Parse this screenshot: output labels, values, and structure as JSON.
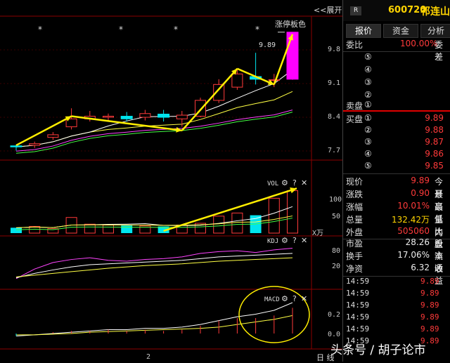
{
  "header": {
    "expand_label": "<<展开",
    "badge": "R",
    "code": "600720",
    "name": "祁连山"
  },
  "tabs": [
    {
      "label": "报价",
      "active": true
    },
    {
      "label": "资金",
      "active": false
    },
    {
      "label": "分析",
      "active": false
    }
  ],
  "main_pane": {
    "limit_label": "涨停板色",
    "limit_price_label": "9.89",
    "stars": [
      "*",
      "*",
      "*",
      "*"
    ],
    "y_ticks": [
      "9.8",
      "9.1",
      "8.4",
      "7.7"
    ]
  },
  "vol_pane": {
    "title": "VOL",
    "y_ticks": [
      "100",
      "50"
    ],
    "unit": "X万"
  },
  "kdj_pane": {
    "title": "KDJ",
    "y_ticks": [
      "80",
      "20"
    ]
  },
  "macd_pane": {
    "title": "MACD",
    "y_ticks": [
      "0.2",
      "0.0"
    ]
  },
  "x_axis": {
    "label": "2",
    "period": "日 线"
  },
  "order_book": {
    "weibi_label": "委比",
    "weibi_value": "100.00%",
    "weicha_label": "委差",
    "sell_label": "卖盘",
    "sell_levels": [
      "⑤",
      "④",
      "③",
      "②",
      "①"
    ],
    "buy_label": "买盘",
    "buy_levels": [
      {
        "level": "①",
        "price": "9.89"
      },
      {
        "level": "②",
        "price": "9.88"
      },
      {
        "level": "③",
        "price": "9.87"
      },
      {
        "level": "④",
        "price": "9.86"
      },
      {
        "level": "⑤",
        "price": "9.85"
      }
    ]
  },
  "quote": [
    {
      "label": "现价",
      "value": "9.89",
      "color": "red",
      "extra": "今开"
    },
    {
      "label": "涨跌",
      "value": "0.90",
      "color": "red",
      "extra": "最高"
    },
    {
      "label": "涨幅",
      "value": "10.01%",
      "color": "red",
      "extra": "最低"
    },
    {
      "label": "总量",
      "value": "132.42万",
      "color": "yel",
      "extra": "量比"
    },
    {
      "label": "外盘",
      "value": "505060",
      "color": "red",
      "extra": "内盘"
    }
  ],
  "stats": [
    {
      "label": "市盈",
      "value": "28.26",
      "extra": "股本"
    },
    {
      "label": "换手",
      "value": "17.06%",
      "extra": "流通"
    },
    {
      "label": "净资",
      "value": "6.32",
      "extra": "收益"
    }
  ],
  "ticks": [
    {
      "time": "14:59",
      "price": "9.89"
    },
    {
      "time": "14:59",
      "price": "9.89"
    },
    {
      "time": "14:59",
      "price": "9.89"
    },
    {
      "time": "14:59",
      "price": "9.89"
    },
    {
      "time": "14:59",
      "price": "9.89"
    },
    {
      "time": "14:59",
      "price": "9.89"
    }
  ],
  "watermark": "头条号 / 胡子论市",
  "colors": {
    "up": "#ff3a3a",
    "down": "#00e5ee",
    "limit_up": "#ff00ff",
    "annotation": "#ffee00",
    "ma5": "#ffffff",
    "ma10": "#ffff44",
    "ma20": "#ff44ff",
    "ma60": "#44ff44"
  },
  "chart_data": {
    "type": "candlestick",
    "candles": [
      {
        "o": 7.74,
        "c": 7.72,
        "h": 7.76,
        "l": 7.65
      },
      {
        "o": 7.75,
        "c": 7.78,
        "h": 7.82,
        "l": 7.7
      },
      {
        "o": 7.9,
        "c": 7.95,
        "h": 8.0,
        "l": 7.85
      },
      {
        "o": 8.1,
        "c": 8.25,
        "h": 8.45,
        "l": 8.05
      },
      {
        "o": 8.25,
        "c": 8.3,
        "h": 8.4,
        "l": 8.2
      },
      {
        "o": 8.28,
        "c": 8.3,
        "h": 8.35,
        "l": 8.22
      },
      {
        "o": 8.3,
        "c": 8.25,
        "h": 8.38,
        "l": 8.2
      },
      {
        "o": 8.28,
        "c": 8.35,
        "h": 8.42,
        "l": 8.22
      },
      {
        "o": 8.34,
        "c": 8.28,
        "h": 8.42,
        "l": 8.2
      },
      {
        "o": 8.25,
        "c": 8.32,
        "h": 8.4,
        "l": 8.1
      },
      {
        "o": 8.3,
        "c": 8.6,
        "h": 8.65,
        "l": 8.28
      },
      {
        "o": 8.6,
        "c": 8.9,
        "h": 9.0,
        "l": 8.55
      },
      {
        "o": 8.85,
        "c": 9.1,
        "h": 9.2,
        "l": 8.8
      },
      {
        "o": 9.05,
        "c": 9.0,
        "h": 9.5,
        "l": 8.9
      },
      {
        "o": 8.99,
        "c": 8.99,
        "h": 9.1,
        "l": 8.85
      },
      {
        "o": 9.0,
        "c": 9.89,
        "h": 9.89,
        "l": 8.99
      }
    ],
    "volume": [
      12,
      15,
      10,
      35,
      20,
      18,
      17,
      16,
      15,
      18,
      22,
      38,
      45,
      40,
      78,
      95
    ],
    "y_ticks": [
      9.8,
      9.1,
      8.4,
      7.7
    ],
    "ylim": [
      7.55,
      10.1
    ]
  }
}
